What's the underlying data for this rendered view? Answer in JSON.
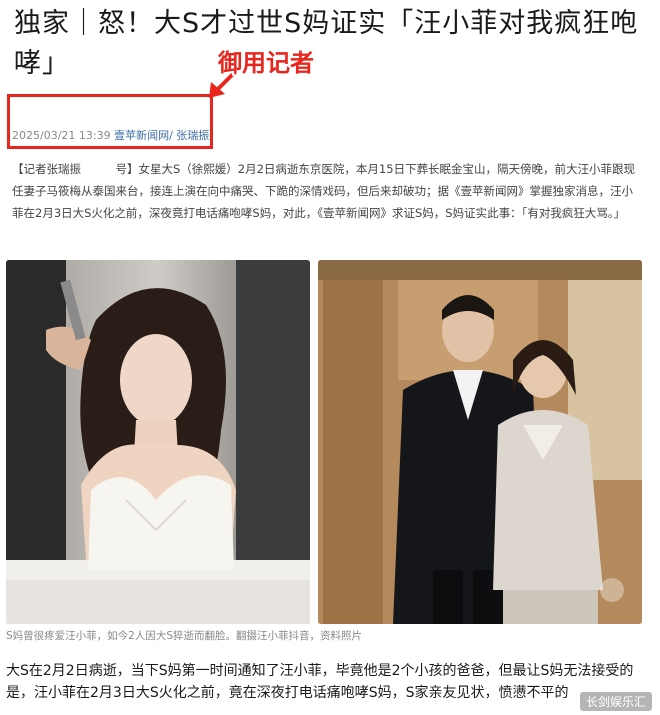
{
  "headline": "独家｜怒！大S才过世S妈证实「汪小菲对我疯狂咆哮」",
  "stamp": "御用记者",
  "meta": {
    "timestamp": "2025/03/21 13:39",
    "source": "壹苹新闻网/ 张瑞振"
  },
  "article": {
    "paragraph": "【记者张瑞振　　　号】女星大S（徐熙媛）2月2日病逝东京医院，本月15日下葬长眠金宝山，隔天傍晚，前大汪小菲跟现任妻子马筱梅从泰国来台，接连上演在向中痛哭、下跪的深情戏码，但后来却破功；据《壹苹新闻网》掌握独家消息，汪小菲在2月3日大S火化之前，深夜竟打电话痛咆哮S妈，对此，《壹苹新闻网》求证S妈，S妈证实此事：「有对我疯狂大骂。」"
  },
  "photo_caption": "S妈曾很疼爱汪小菲，如今2人因大S猝逝而翻脸。翻摄汪小菲抖音，资料照片",
  "body_text": "大S在2月2日病逝，当下S妈第一时间通知了汪小菲，毕竟他是2个小孩的爸爸，但最让S妈无法接受的是，汪小菲在2月3日大S火化之前，竟在深夜打电话痛咆哮S妈，S家亲友见状，愤懑不平的",
  "watermark": "长剑娱乐汇",
  "colors": {
    "accent_red": "#e8261e",
    "source_blue": "#3f6ea8"
  }
}
